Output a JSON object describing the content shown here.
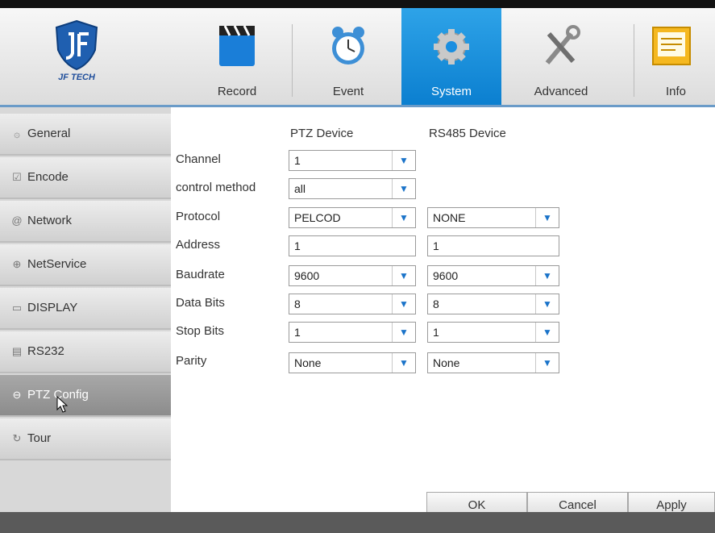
{
  "logo": {
    "text": "JF TECH"
  },
  "nav": [
    {
      "label": "Record",
      "icon": "record-clapper-icon"
    },
    {
      "label": "Event",
      "icon": "alarm-clock-icon"
    },
    {
      "label": "System",
      "icon": "gear-icon",
      "active": true
    },
    {
      "label": "Advanced",
      "icon": "tools-icon"
    },
    {
      "label": "Info",
      "icon": "info-screen-icon"
    }
  ],
  "sidebar": {
    "items": [
      {
        "label": "General",
        "icon": "general-settings-icon",
        "glyph": "۞"
      },
      {
        "label": "Encode",
        "icon": "encode-icon",
        "glyph": "☑"
      },
      {
        "label": "Network",
        "icon": "network-at-icon",
        "glyph": "@"
      },
      {
        "label": "NetService",
        "icon": "globe-icon",
        "glyph": "⊕"
      },
      {
        "label": "DISPLAY",
        "icon": "display-icon",
        "glyph": "▭"
      },
      {
        "label": "RS232",
        "icon": "serial-port-icon",
        "glyph": "▤"
      },
      {
        "label": "PTZ Config",
        "icon": "ptz-icon",
        "glyph": "⊖",
        "active": true
      },
      {
        "label": "Tour",
        "icon": "tour-icon",
        "glyph": "↻"
      }
    ]
  },
  "form": {
    "ptz_header": "PTZ Device",
    "rs485_header": "RS485 Device",
    "rows": {
      "channel": {
        "label": "Channel",
        "ptz": "1"
      },
      "control_method": {
        "label": "control method",
        "ptz": "all"
      },
      "protocol": {
        "label": "Protocol",
        "ptz": "PELCOD",
        "rs485": "NONE"
      },
      "address": {
        "label": "Address",
        "ptz": "1",
        "rs485": "1"
      },
      "baudrate": {
        "label": "Baudrate",
        "ptz": "9600",
        "rs485": "9600"
      },
      "data_bits": {
        "label": "Data Bits",
        "ptz": "8",
        "rs485": "8"
      },
      "stop_bits": {
        "label": "Stop Bits",
        "ptz": "1",
        "rs485": "1"
      },
      "parity": {
        "label": "Parity",
        "ptz": "None",
        "rs485": "None"
      }
    },
    "dropdown_arrow": "▼"
  },
  "buttons": {
    "ok": "OK",
    "cancel": "Cancel",
    "apply": "Apply"
  },
  "colors": {
    "accent": "#1a8ee0",
    "arrow": "#1a73c9"
  }
}
